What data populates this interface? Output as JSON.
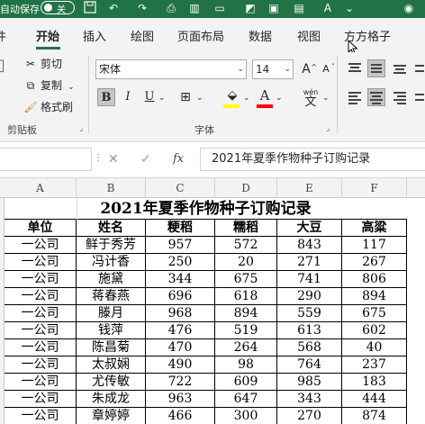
{
  "titlebar": {
    "autosave_label": "自动保存",
    "autosave_state": "关",
    "accent": "#217346"
  },
  "tabs": [
    {
      "label": "件"
    },
    {
      "label": "开始",
      "active": true
    },
    {
      "label": "插入"
    },
    {
      "label": "绘图"
    },
    {
      "label": "页面布局"
    },
    {
      "label": "数据"
    },
    {
      "label": "视图"
    },
    {
      "label": "方方格子"
    }
  ],
  "ribbon": {
    "clipboard": {
      "cut": "剪切",
      "copy": "复制",
      "format_painter": "格式刷",
      "group_label": "剪贴板"
    },
    "font": {
      "font_name": "宋体",
      "font_size": "14",
      "group_label": "字体",
      "bold": "B",
      "italic": "I",
      "underline": "U",
      "grow": "A",
      "shrink": "A",
      "phonetic_label": "wén",
      "highlight_color": "#ffff00",
      "font_color": "#ff0000"
    }
  },
  "formula_bar": {
    "formula_text": "2021年夏季作物种子订购记录",
    "fx_label": "fx"
  },
  "columns": [
    "A",
    "B",
    "C",
    "D",
    "E",
    "F"
  ],
  "sheet": {
    "title": "2021年夏季作物种子订购记录",
    "headers": [
      "单位",
      "姓名",
      "粳稻",
      "糯稻",
      "大豆",
      "高粱"
    ],
    "rows": [
      [
        "一公司",
        "鲜于秀芳",
        "957",
        "572",
        "843",
        "117"
      ],
      [
        "一公司",
        "冯计香",
        "250",
        "20",
        "271",
        "267"
      ],
      [
        "一公司",
        "施黛",
        "344",
        "675",
        "741",
        "806"
      ],
      [
        "一公司",
        "蒋春燕",
        "696",
        "618",
        "290",
        "894"
      ],
      [
        "一公司",
        "滕月",
        "968",
        "894",
        "559",
        "675"
      ],
      [
        "一公司",
        "钱萍",
        "476",
        "519",
        "613",
        "602"
      ],
      [
        "一公司",
        "陈昌菊",
        "470",
        "264",
        "568",
        "40"
      ],
      [
        "一公司",
        "太叔娴",
        "490",
        "98",
        "764",
        "237"
      ],
      [
        "一公司",
        "尤传敏",
        "722",
        "609",
        "985",
        "183"
      ],
      [
        "一公司",
        "朱成龙",
        "963",
        "647",
        "343",
        "444"
      ],
      [
        "一公司",
        "章婷婷",
        "466",
        "300",
        "270",
        "874"
      ]
    ]
  }
}
